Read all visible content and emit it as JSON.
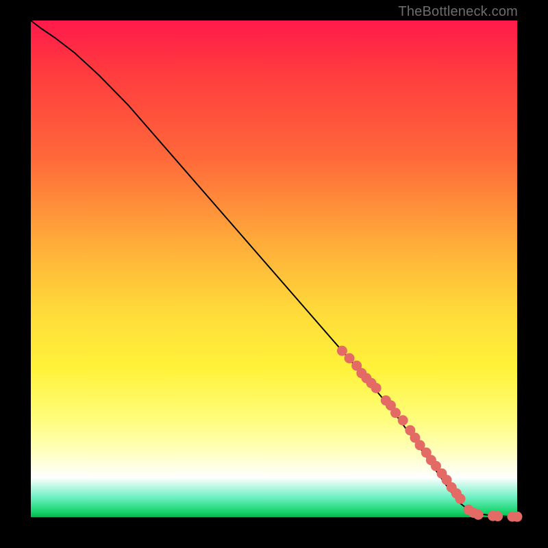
{
  "watermark": "TheBottleneck.com",
  "colors": {
    "marker_fill": "#e46a66",
    "curve_stroke": "#000000"
  },
  "chart_data": {
    "type": "line",
    "title": "",
    "xlabel": "",
    "ylabel": "",
    "xlim": [
      0,
      100
    ],
    "ylim": [
      0,
      100
    ],
    "grid": false,
    "legend": false,
    "series": [
      {
        "name": "curve",
        "kind": "line",
        "x": [
          0,
          2,
          5,
          9,
          14,
          20,
          28,
          36,
          44,
          52,
          60,
          68,
          74,
          80,
          85,
          88,
          90,
          92,
          95,
          98,
          100
        ],
        "y": [
          100,
          98.5,
          96.5,
          93.5,
          89,
          83,
          74,
          65,
          56,
          47,
          38,
          29,
          22,
          14,
          7,
          3,
          1.5,
          0.7,
          0.3,
          0.15,
          0.1
        ]
      },
      {
        "name": "markers",
        "kind": "scatter",
        "x": [
          64,
          65.5,
          67,
          68,
          69,
          70,
          71,
          73,
          74,
          75,
          76.5,
          78,
          79,
          80,
          81.3,
          82.3,
          83.3,
          84.5,
          85.5,
          86.5,
          87.5,
          88.3,
          90,
          91,
          92,
          95,
          96,
          99,
          100
        ],
        "y": [
          33.5,
          32,
          30.5,
          29,
          28,
          27,
          26,
          23.5,
          22.5,
          21,
          19.5,
          17.5,
          16,
          14.5,
          13,
          11.5,
          10.3,
          8.8,
          7.5,
          6,
          4.8,
          3.7,
          1.5,
          0.9,
          0.5,
          0.25,
          0.2,
          0.12,
          0.1
        ]
      }
    ]
  }
}
